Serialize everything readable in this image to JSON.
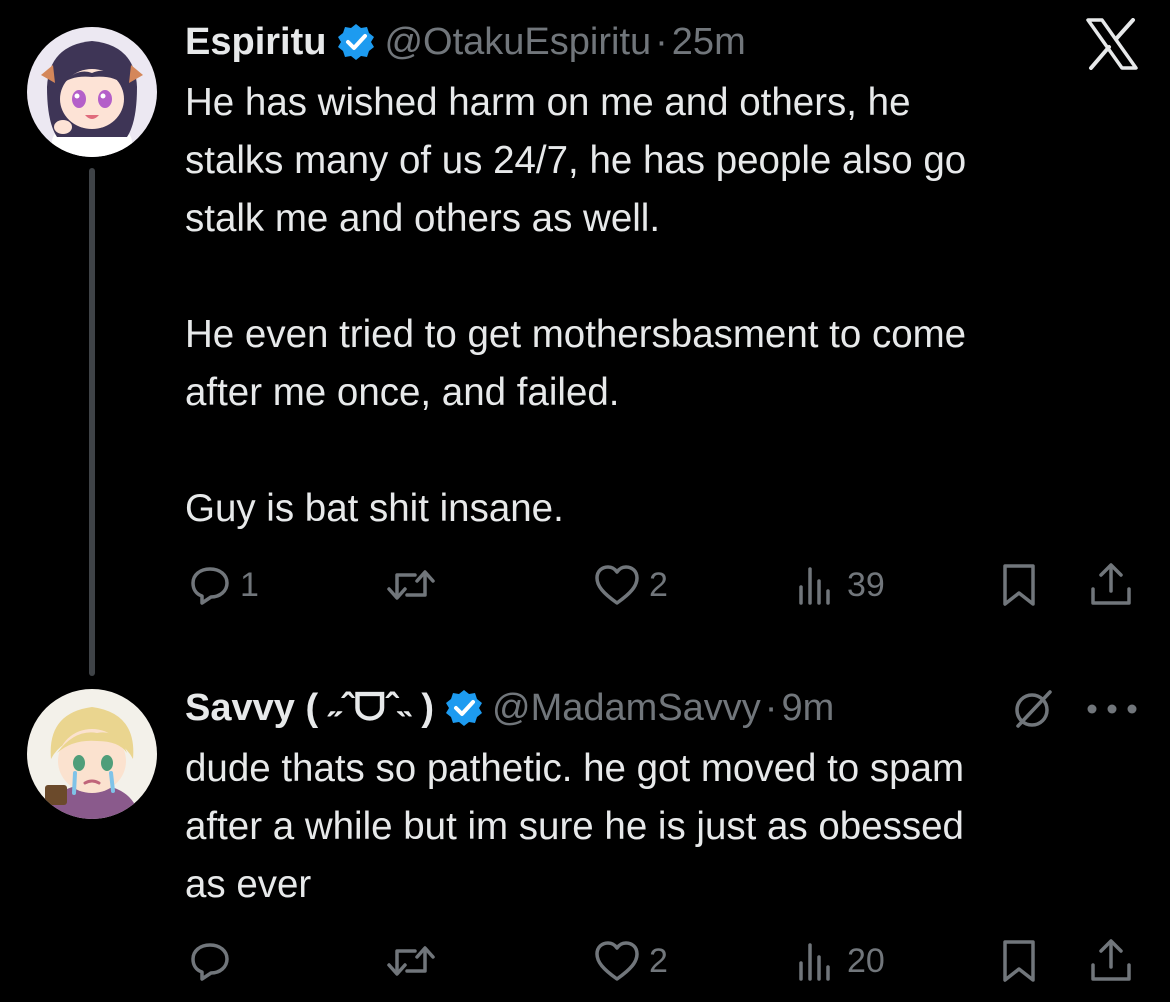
{
  "app_logo": "x-logo",
  "colors": {
    "background": "#000000",
    "text": "#e7e9ea",
    "secondary_text": "#71767b",
    "verified_badge": "#1d9bf0",
    "thread_line": "#3f4347"
  },
  "tweets": [
    {
      "display_name": "Espiritu",
      "verified": true,
      "handle": "@OtakuEspiritu",
      "separator": "·",
      "time": "25m",
      "text": "He has wished harm on me and others, he\nstalks many of us 24/7, he has people also go\nstalk me and others as well.\n\nHe even tried to get mothersbasment to come\nafter me once, and failed.\n\nGuy is bat shit insane.",
      "reply_count": "1",
      "retweet_count": "",
      "like_count": "2",
      "view_count": "39",
      "icons": [
        "reply-icon",
        "retweet-icon",
        "like-icon",
        "views-icon",
        "bookmark-icon",
        "share-icon"
      ]
    },
    {
      "display_name": "Savvy ( ˶ˆᗜˆ˵ )",
      "verified": true,
      "handle": "@MadamSavvy",
      "separator": "·",
      "time": "9m",
      "text": "dude thats so pathetic. he got moved to spam\nafter a while but im sure he is just as obessed\nas ever",
      "reply_count": "",
      "retweet_count": "",
      "like_count": "2",
      "view_count": "20",
      "icons": [
        "mute-icon",
        "more-icon",
        "reply-icon",
        "retweet-icon",
        "like-icon",
        "views-icon",
        "bookmark-icon",
        "share-icon"
      ]
    }
  ]
}
